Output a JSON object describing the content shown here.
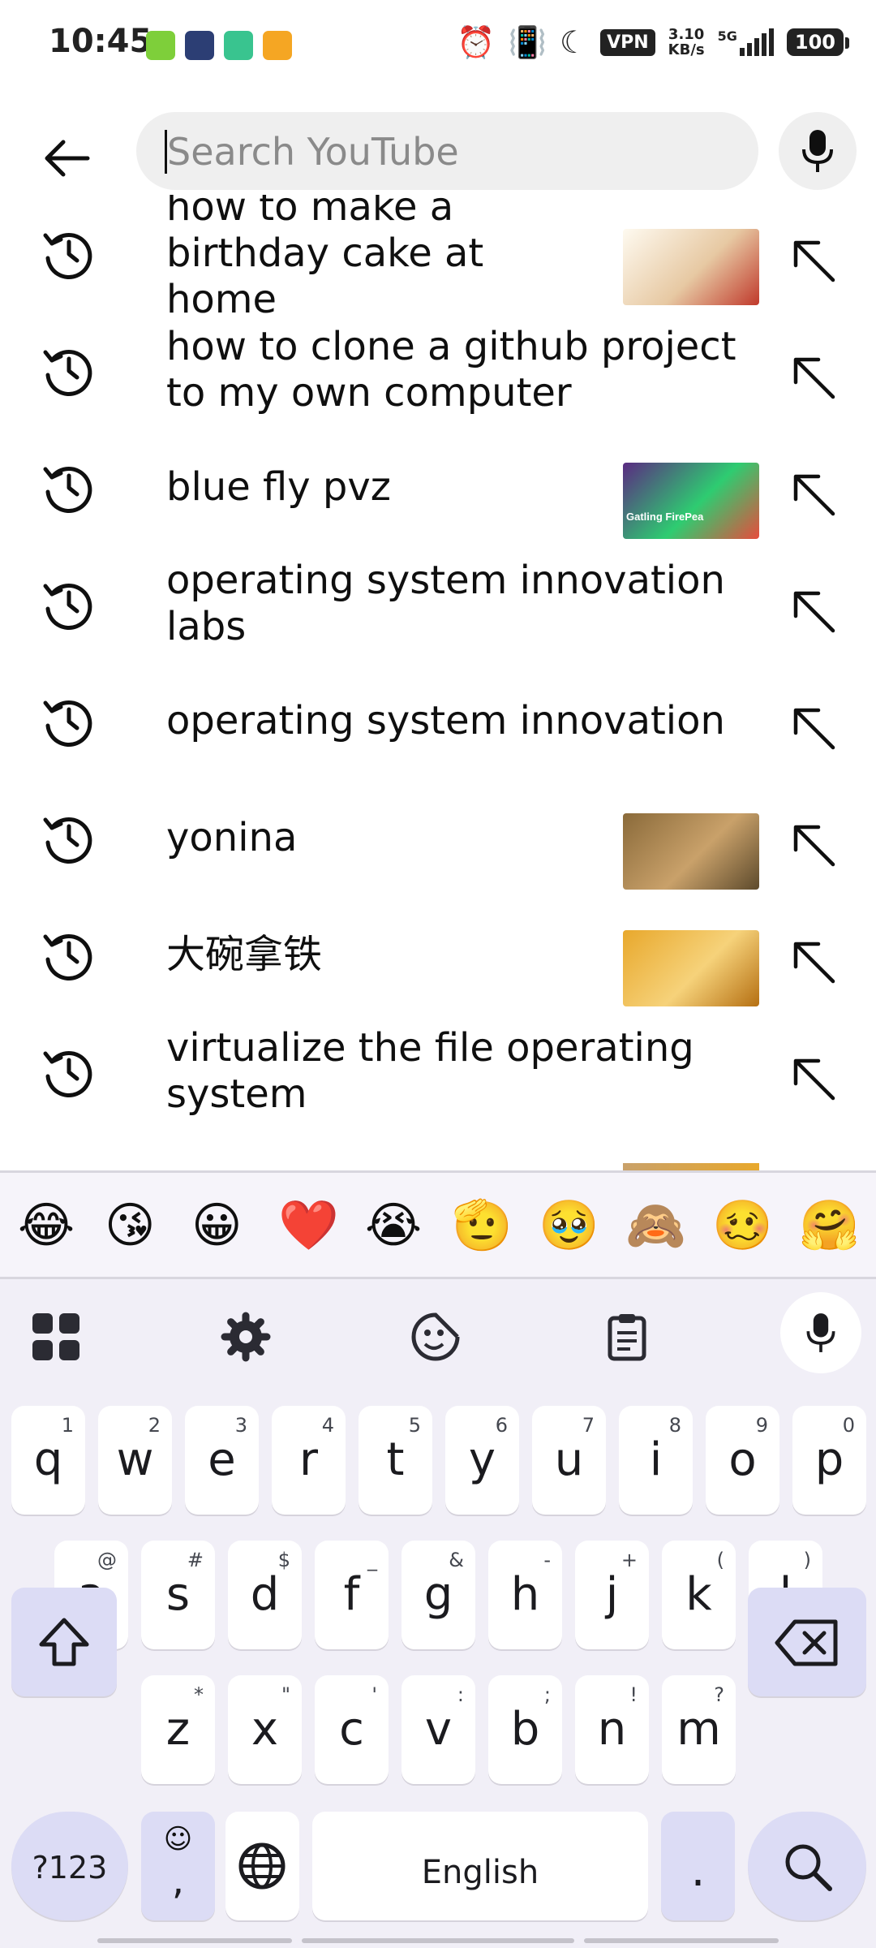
{
  "status_bar": {
    "time": "10:45",
    "vpn": "VPN",
    "net_speed_value": "3.10",
    "net_speed_unit": "KB/s",
    "signal": "5G",
    "battery": "100",
    "notification_colors": [
      "#7ecf3a",
      "#2c3e74",
      "#39c48f",
      "#f5a623"
    ]
  },
  "search": {
    "placeholder": "Search YouTube",
    "value": ""
  },
  "suggestions": [
    {
      "text": "how to make a birthday cake at home",
      "has_thumbnail": true,
      "thumb_colors": [
        "#fefaf0",
        "#e7c9a3",
        "#c0392b"
      ]
    },
    {
      "text": "how to clone a github project to my own computer",
      "has_thumbnail": false
    },
    {
      "text": "blue fly pvz",
      "has_thumbnail": true,
      "thumb_colors": [
        "#5a2a82",
        "#2ecc71",
        "#e74c3c"
      ],
      "thumb_caption": "Gatling FirePea"
    },
    {
      "text": "operating system innovation labs",
      "has_thumbnail": false
    },
    {
      "text": "operating system innovation",
      "has_thumbnail": false
    },
    {
      "text": "yonina",
      "has_thumbnail": true,
      "thumb_colors": [
        "#8a6a3a",
        "#c9a16a",
        "#5d4a2c"
      ]
    },
    {
      "text": "大碗拿铁",
      "has_thumbnail": true,
      "thumb_colors": [
        "#e8a82c",
        "#f6d27a",
        "#b56f12"
      ]
    },
    {
      "text": "virtualize the file operating system",
      "has_thumbnail": false
    }
  ],
  "emoji_bar": [
    "😂",
    "😘",
    "😀",
    "❤️",
    "😭",
    "🫡",
    "🥹",
    "🙈",
    "🥴",
    "🤗"
  ],
  "keyboard": {
    "row1": [
      {
        "key": "q",
        "sup": "1"
      },
      {
        "key": "w",
        "sup": "2"
      },
      {
        "key": "e",
        "sup": "3"
      },
      {
        "key": "r",
        "sup": "4"
      },
      {
        "key": "t",
        "sup": "5"
      },
      {
        "key": "y",
        "sup": "6"
      },
      {
        "key": "u",
        "sup": "7"
      },
      {
        "key": "i",
        "sup": "8"
      },
      {
        "key": "o",
        "sup": "9"
      },
      {
        "key": "p",
        "sup": "0"
      }
    ],
    "row2": [
      {
        "key": "a",
        "sup": "@"
      },
      {
        "key": "s",
        "sup": "#"
      },
      {
        "key": "d",
        "sup": "$"
      },
      {
        "key": "f",
        "sup": "_"
      },
      {
        "key": "g",
        "sup": "&"
      },
      {
        "key": "h",
        "sup": "-"
      },
      {
        "key": "j",
        "sup": "+"
      },
      {
        "key": "k",
        "sup": "("
      },
      {
        "key": "l",
        "sup": ")"
      }
    ],
    "row3": [
      {
        "key": "z",
        "sup": "*"
      },
      {
        "key": "x",
        "sup": "\""
      },
      {
        "key": "c",
        "sup": "'"
      },
      {
        "key": "v",
        "sup": ":"
      },
      {
        "key": "b",
        "sup": ";"
      },
      {
        "key": "n",
        "sup": "!"
      },
      {
        "key": "m",
        "sup": "?"
      }
    ],
    "symbols_key": "?123",
    "comma_key": ",",
    "space_label": "English",
    "period_key": "."
  },
  "colors": {
    "keyboard_bg": "#f1eff7",
    "modifier_key": "#dcdcf5",
    "search_field": "#efefef"
  }
}
